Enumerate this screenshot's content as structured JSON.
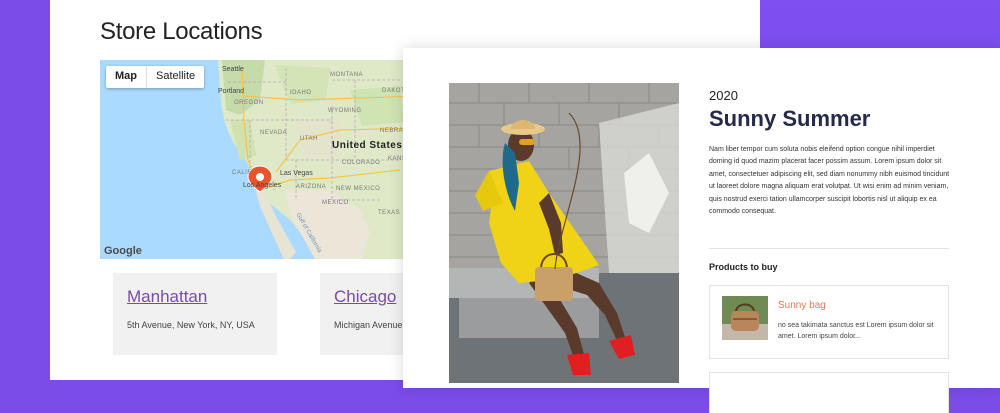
{
  "stores": {
    "title": "Store Locations",
    "map": {
      "toggle": {
        "map": "Map",
        "satellite": "Satellite"
      },
      "provider": "Google",
      "labels": {
        "seattle": "Seattle",
        "portland": "Portland",
        "us": "United States",
        "las_vegas": "Las Vegas",
        "los_angeles": "Los Angeles",
        "mexico": "MEXICO",
        "nevada": "NEVADA",
        "california": "CALIF",
        "oregon": "OREGON",
        "idaho": "IDAHO",
        "montana": "MONTANA",
        "wyoming": "WYOMING",
        "utah": "UTAH",
        "colorado": "COLORADO",
        "arizona": "ARIZONA",
        "new_mexico": "NEW MEXICO",
        "nebraska": "NEBRASKA",
        "kansas": "KANSAS",
        "dakota": "DAKOTA",
        "texas": "TEXAS",
        "gulf": "Gulf of California"
      }
    },
    "cards": [
      {
        "city": "Manhattan",
        "address": "5th Avenue, New York, NY, USA"
      },
      {
        "city": "Chicago",
        "address": "Michigan Avenue, Chicago, IL, USA"
      }
    ]
  },
  "article": {
    "year": "2020",
    "title": "Sunny Summer",
    "body": "Nam liber tempor cum soluta nobis eleifend option congue nihil imperdiet doming id quod mazim placerat facer possim assum. Lorem ipsum dolor sit amet, consectetuer adipiscing elit, sed diam nonummy nibh euismod tincidunt ut laoreet dolore magna aliquam erat volutpat. Ut wisi enim ad minim veniam, quis nostrud exerci tation ullamcorper suscipit lobortis nisl ut aliquip ex ea commodo consequat.",
    "products_heading": "Products to buy",
    "products": [
      {
        "name": "Sunny bag",
        "description": "no sea takimata sanctus est Lorem ipsum dolor sit amet. Lorem ipsum dolor..."
      }
    ]
  },
  "colors": {
    "accent_purple": "#7b4ce8",
    "link_purple": "#7a4ba6",
    "product_orange": "#e07a4f",
    "title_navy": "#262a4a",
    "marker": "#e8552c"
  },
  "icons": {
    "map_marker": "map-pin-icon",
    "product_image": "bag-thumbnail"
  }
}
